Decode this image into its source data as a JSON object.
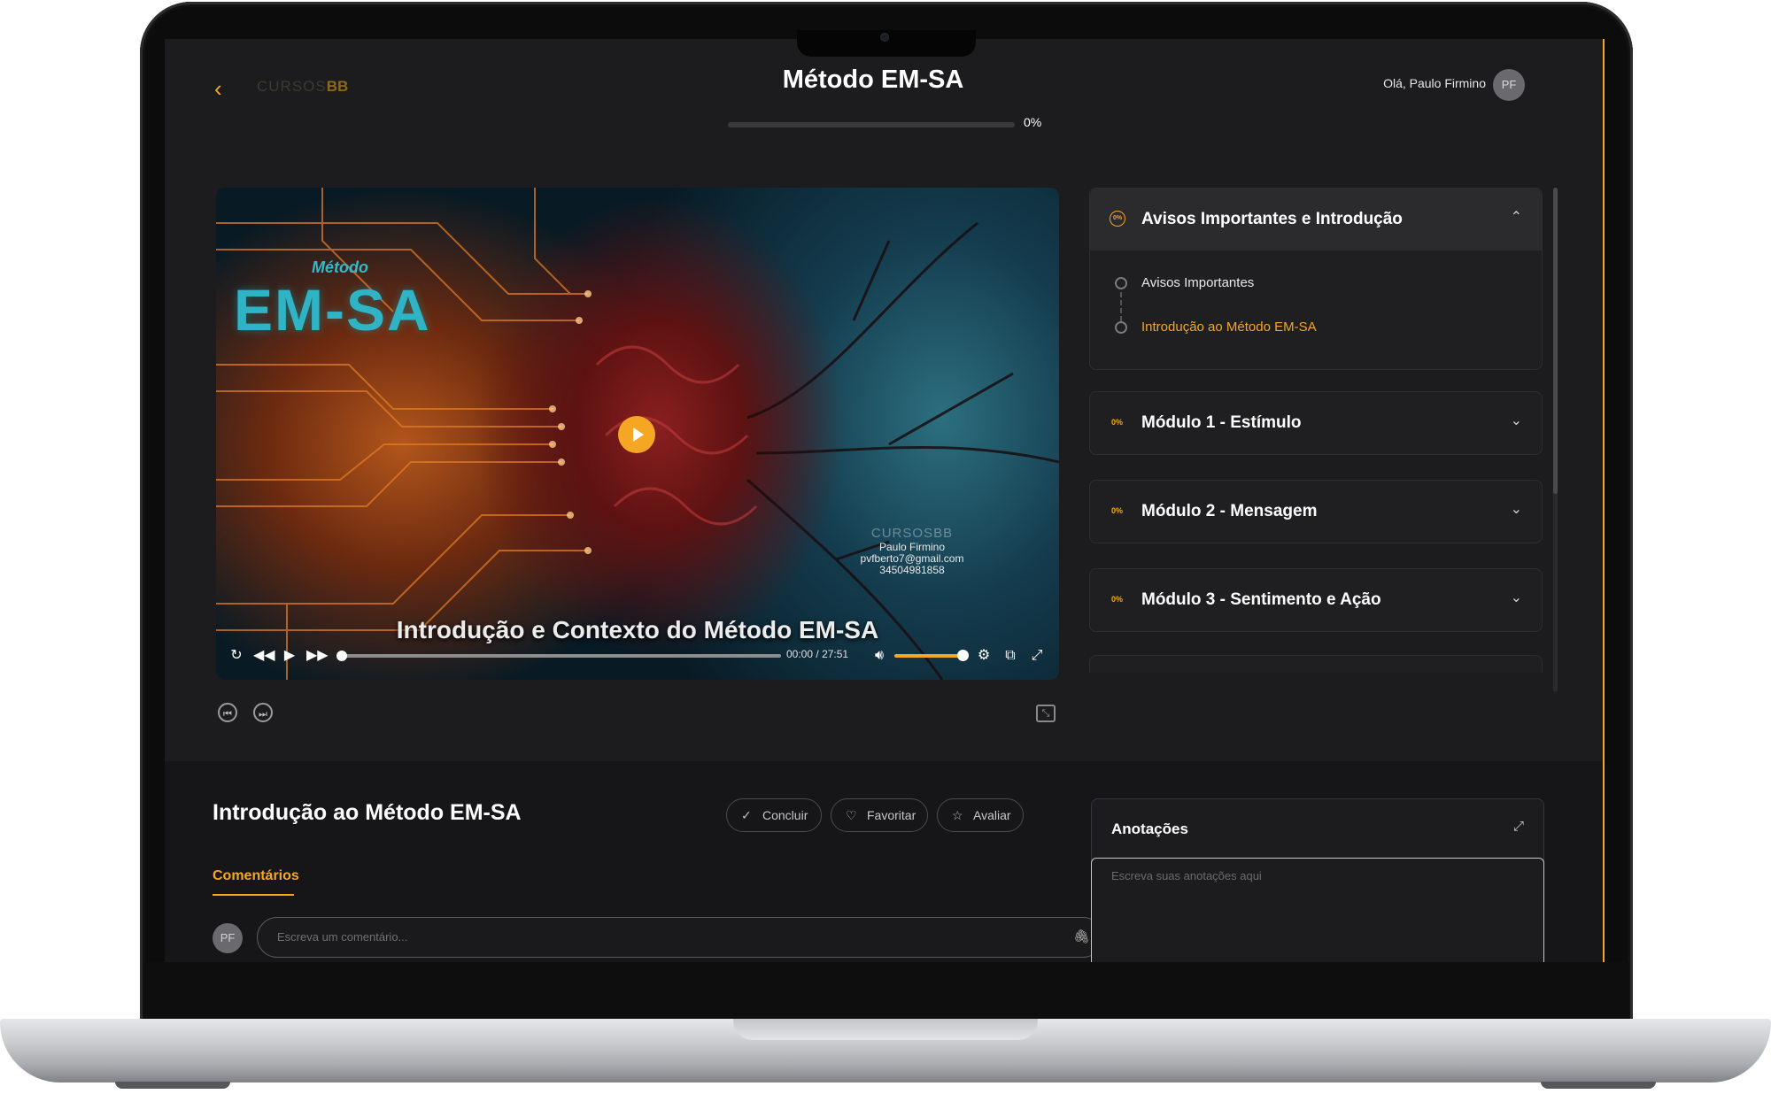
{
  "header": {
    "logo_text": "CURSOS",
    "logo_accent": "BB",
    "course_title": "Método EM-SA",
    "progress_percent": 0,
    "progress_label": "0%",
    "greeting": "Olá, Paulo Firmino",
    "avatar_initials": "PF"
  },
  "video": {
    "brand_small": "Método",
    "brand_big": "EM-SA",
    "caption": "Introdução e Contexto do Método EM-SA",
    "watermark_logo": "CURSOS",
    "watermark_logo_accent": "BB",
    "watermark_name": "Paulo Firmino",
    "watermark_email": "pvfberto7@gmail.com",
    "watermark_id": "34504981858",
    "current_time": "00:00",
    "time_separator": "/",
    "duration": "27:51",
    "seek_position": 0,
    "volume_level": 1.0
  },
  "sidebar": {
    "modules": [
      {
        "percent": "0%",
        "title": "Avisos Importantes e Introdução",
        "expanded": true,
        "lessons": [
          {
            "title": "Avisos Importantes",
            "active": false
          },
          {
            "title": "Introdução ao Método EM-SA",
            "active": true
          }
        ]
      },
      {
        "percent": "0%",
        "title": "Módulo 1 - Estímulo",
        "expanded": false
      },
      {
        "percent": "0%",
        "title": "Módulo 2 - Mensagem",
        "expanded": false
      },
      {
        "percent": "0%",
        "title": "Módulo 3 - Sentimento e Ação",
        "expanded": false
      }
    ]
  },
  "lesson": {
    "title": "Introdução ao Método EM-SA",
    "actions": [
      {
        "label": "Concluir",
        "icon": "check-icon"
      },
      {
        "label": "Favoritar",
        "icon": "heart-icon"
      },
      {
        "label": "Avaliar",
        "icon": "star-icon"
      }
    ],
    "tabs": [
      "Comentários"
    ],
    "comment_avatar": "PF",
    "comment_placeholder": "Escreva um comentário..."
  },
  "notes": {
    "title": "Anotações",
    "placeholder": "Escreva suas anotações aqui"
  },
  "colors": {
    "accent": "#f5a623",
    "background": "#1c1c1e",
    "panel": "#1f1f21"
  }
}
